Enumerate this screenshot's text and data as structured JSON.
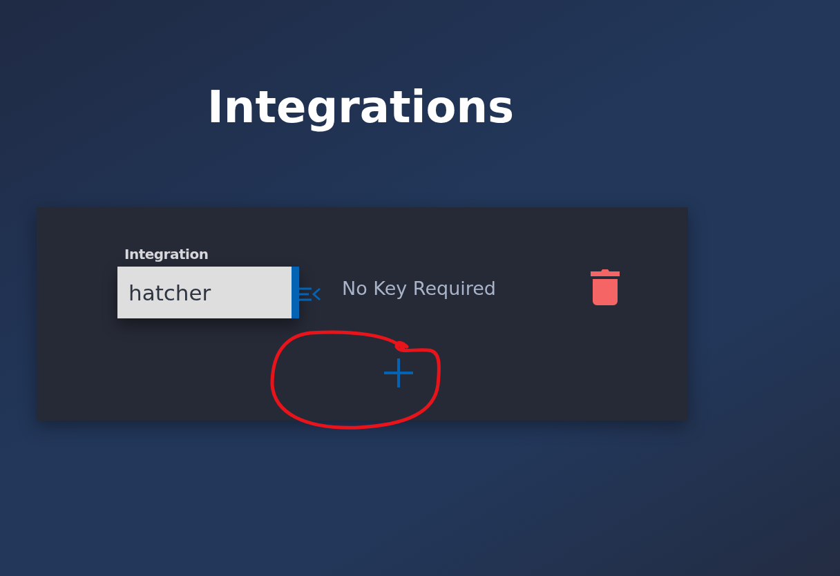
{
  "page": {
    "title": "Integrations"
  },
  "integrations": [
    {
      "label": "Integration",
      "value": "hatcher",
      "key_status": "No Key Required"
    }
  ]
}
